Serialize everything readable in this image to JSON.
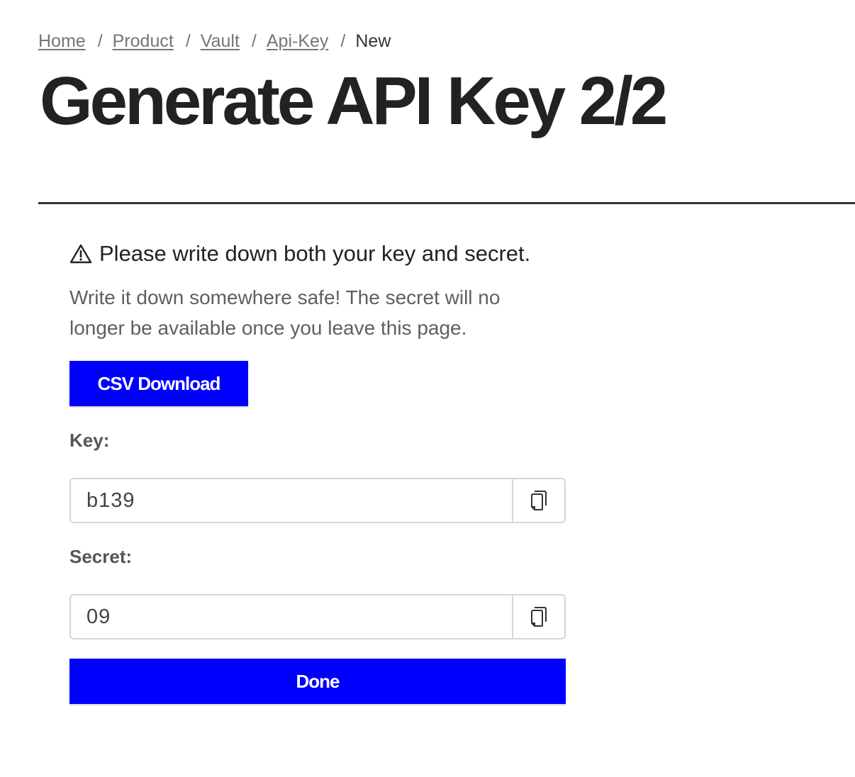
{
  "breadcrumb": {
    "items": [
      {
        "label": "Home"
      },
      {
        "label": "Product"
      },
      {
        "label": "Vault"
      },
      {
        "label": "Api-Key"
      }
    ],
    "separator": "/",
    "current": "New"
  },
  "page_title": "Generate API Key 2/2",
  "warning": {
    "icon": "warning-triangle-icon",
    "text": "Please write down both your key and secret."
  },
  "info_text": "Write it down somewhere safe! The secret will no longer be available once you leave this page.",
  "csv_button": {
    "label": "CSV Download"
  },
  "key_field": {
    "label": "Key:",
    "value": "b139",
    "copy_icon": "copy-icon"
  },
  "secret_field": {
    "label": "Secret:",
    "value": "09",
    "copy_icon": "copy-icon"
  },
  "done_button": {
    "label": "Done"
  },
  "colors": {
    "primary_button": "#0000ff",
    "text_dark": "#222222",
    "text_muted": "#747676",
    "border": "#d6d6d6"
  }
}
